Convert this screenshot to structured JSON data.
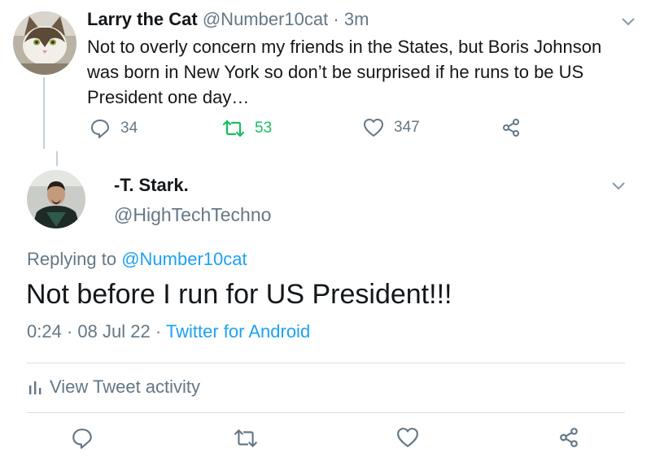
{
  "parent_tweet": {
    "name": "Larry the Cat",
    "handle": "@Number10cat",
    "separator": "·",
    "time": "3m",
    "text": "Not to overly concern my friends in the States, but Boris Johnson was born in New York so don’t be surprised if he runs to be US President one day…",
    "reply_count": "34",
    "retweet_count": "53",
    "like_count": "347",
    "avatar_icon": "cat-avatar",
    "retweet_color": "#17bf63"
  },
  "reply_tweet": {
    "name": "-T. Stark.",
    "handle": "@HighTechTechno",
    "replying_prefix": "Replying to",
    "replying_mention": "@Number10cat",
    "text": "Not before I run for US President!!!",
    "time": "0:24",
    "separator": "·",
    "date": "08 Jul 22",
    "source": "Twitter for Android",
    "avatar_icon": "person-avatar"
  },
  "activity": {
    "label": "View Tweet activity",
    "icon": "bar-chart-icon"
  },
  "colors": {
    "link": "#1da1f2",
    "secondary_text": "#657786",
    "primary_text": "#14171a"
  }
}
